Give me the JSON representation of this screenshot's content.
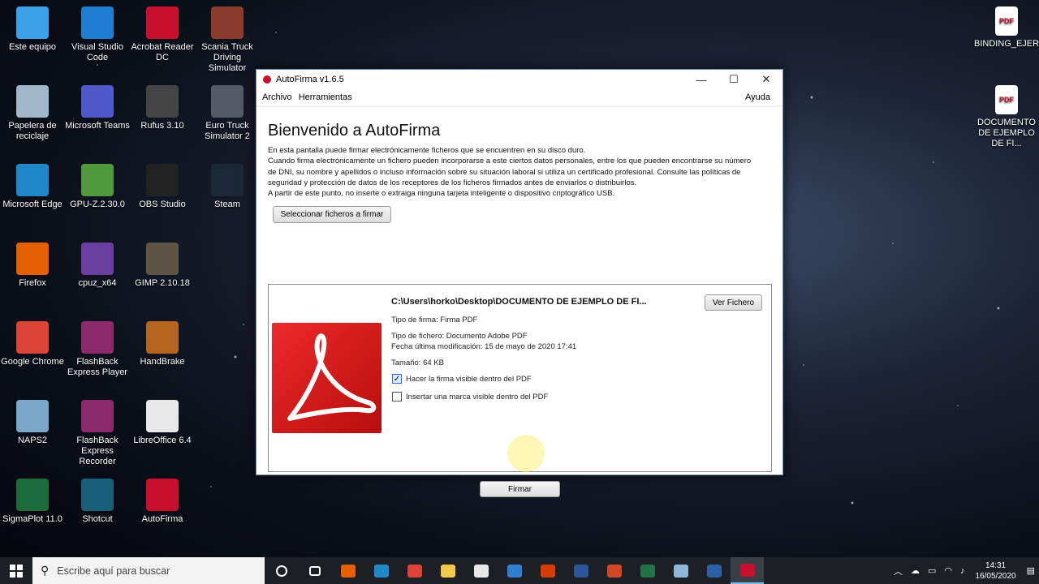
{
  "desktop_icons": [
    {
      "label": "Este equipo",
      "icon": "computer-icon",
      "color": "#3aa0e8"
    },
    {
      "label": "Visual Studio Code",
      "icon": "vscode-icon",
      "color": "#1f7ed4"
    },
    {
      "label": "Acrobat Reader DC",
      "icon": "acrobat-icon",
      "color": "#c8102e"
    },
    {
      "label": "Scania Truck Driving Simulator",
      "icon": "truck-icon",
      "color": "#8a3b2e"
    },
    {
      "label": "BINDING_EJER...",
      "icon": "pdf-file-icon",
      "color": "#ffffff"
    },
    {
      "label": "Papelera de reciclaje",
      "icon": "recycle-bin-icon",
      "color": "#9fb7c9"
    },
    {
      "label": "Microsoft Teams",
      "icon": "teams-icon",
      "color": "#5059c9"
    },
    {
      "label": "Rufus 3.10",
      "icon": "rufus-icon",
      "color": "#444444"
    },
    {
      "label": "Euro Truck Simulator 2",
      "icon": "truck-icon",
      "color": "#555a66"
    },
    {
      "label": "DOCUMENTO DE EJEMPLO DE FI...",
      "icon": "pdf-file-icon",
      "color": "#ffffff"
    },
    {
      "label": "Microsoft Edge",
      "icon": "edge-icon",
      "color": "#1e88c8"
    },
    {
      "label": "GPU-Z.2.30.0",
      "icon": "gpuz-icon",
      "color": "#4e9a3c"
    },
    {
      "label": "OBS Studio",
      "icon": "obs-icon",
      "color": "#222222"
    },
    {
      "label": "Steam",
      "icon": "steam-icon",
      "color": "#1b2838"
    },
    {
      "label": "Firefox",
      "icon": "firefox-icon",
      "color": "#e66000"
    },
    {
      "label": "cpuz_x64",
      "icon": "cpuz-icon",
      "color": "#6b3fa0"
    },
    {
      "label": "GIMP 2.10.18",
      "icon": "gimp-icon",
      "color": "#5c5543"
    },
    {
      "label": "Google Chrome",
      "icon": "chrome-icon",
      "color": "#db4437"
    },
    {
      "label": "FlashBack Express Player",
      "icon": "flashback-icon",
      "color": "#8b2a6b"
    },
    {
      "label": "HandBrake",
      "icon": "handbrake-icon",
      "color": "#b5651d"
    },
    {
      "label": "NAPS2",
      "icon": "scanner-icon",
      "color": "#7aa7c7"
    },
    {
      "label": "FlashBack Express Recorder",
      "icon": "flashback-icon",
      "color": "#8b2a6b"
    },
    {
      "label": "LibreOffice 6.4",
      "icon": "libreoffice-icon",
      "color": "#e8e8e8"
    },
    {
      "label": "SigmaPlot 11.0",
      "icon": "sigmaplot-icon",
      "color": "#1c6b3a"
    },
    {
      "label": "Shotcut",
      "icon": "shotcut-icon",
      "color": "#1a5f7a"
    },
    {
      "label": "AutoFirma",
      "icon": "autofirma-icon",
      "color": "#c8102e"
    }
  ],
  "window": {
    "title": "AutoFirma v1.6.5",
    "menu": {
      "archivo": "Archivo",
      "herramientas": "Herramientas",
      "ayuda": "Ayuda"
    },
    "heading": "Bienvenido a AutoFirma",
    "intro": [
      "En esta pantalla puede firmar electrónicamente ficheros que se encuentren en su disco duro.",
      "Cuando firma electrónicamente un fichero pueden incorporarse a este ciertos datos personales, entre los que pueden encontrarse su número",
      "de DNI, su nombre y apellidos o incluso información sobre su situación laboral si utiliza un certificado profesional. Consulte las políticas de",
      "seguridad y protección de datos de los receptores de los ficheros firmados antes de enviarlos o distribuirlos.",
      "A partir de este punto, no inserte o extraiga ninguna tarjeta inteligente o dispositivo criptográfico USB."
    ],
    "select_button": "Seleccionar ficheros a firmar",
    "file": {
      "path": "C:\\Users\\horko\\Desktop\\DOCUMENTO DE EJEMPLO DE FI...",
      "view_button": "Ver Fichero",
      "sign_type": "Tipo de firma: Firma PDF",
      "file_type": "Tipo de fichero: Documento Adobe PDF",
      "modified": "Fecha última modificación: 15 de mayo de 2020 17:41",
      "size": "Tamaño: 64 KB",
      "visible_signature": {
        "label": "Hacer la firma visible dentro del PDF",
        "checked": true
      },
      "visible_mark": {
        "label": "Insertar una marca visible dentro del PDF",
        "checked": false
      }
    },
    "sign_button": "Firmar"
  },
  "taskbar": {
    "search_placeholder": "Escribe aquí para buscar",
    "apps": [
      {
        "icon": "cortana-icon",
        "color": "#ffffff"
      },
      {
        "icon": "task-view-icon",
        "color": "#ffffff"
      },
      {
        "icon": "firefox-icon",
        "color": "#e66000"
      },
      {
        "icon": "edge-icon",
        "color": "#1e88c8"
      },
      {
        "icon": "chrome-icon",
        "color": "#db4437"
      },
      {
        "icon": "file-explorer-icon",
        "color": "#f2c94c"
      },
      {
        "icon": "store-icon",
        "color": "#e8e8e8"
      },
      {
        "icon": "mail-icon",
        "color": "#2f7fd1"
      },
      {
        "icon": "office-icon",
        "color": "#d83b01"
      },
      {
        "icon": "word-icon",
        "color": "#2b579a"
      },
      {
        "icon": "powerpoint-icon",
        "color": "#d24726"
      },
      {
        "icon": "excel-icon",
        "color": "#217346"
      },
      {
        "icon": "app-icon",
        "color": "#8fb8d8"
      },
      {
        "icon": "powershell-icon",
        "color": "#2d5fa6"
      },
      {
        "icon": "autofirma-icon",
        "color": "#c8102e"
      }
    ],
    "time": "14:31",
    "date": "16/05/2020"
  }
}
